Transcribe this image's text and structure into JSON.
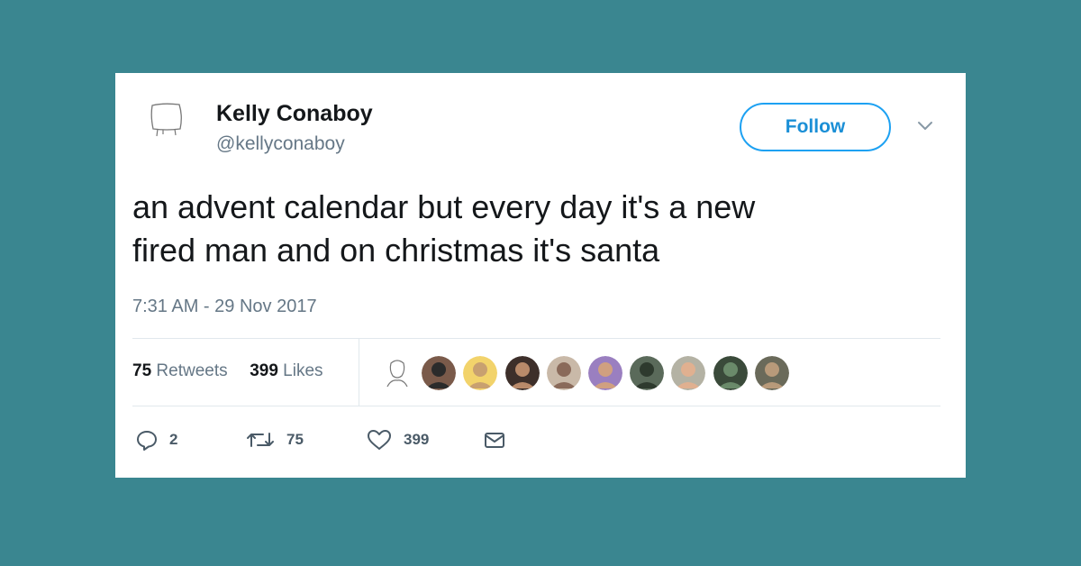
{
  "tweet": {
    "author_name": "Kelly Conaboy",
    "author_handle": "@kellyconaboy",
    "follow_label": "Follow",
    "text_line1": "an advent calendar but every day it's a new",
    "text_line2": "fired man and on christmas it's santa",
    "timestamp": "7:31 AM - 29 Nov 2017"
  },
  "stats": {
    "retweets_count": "75",
    "retweets_label": "Retweets",
    "likes_count": "399",
    "likes_label": "Likes"
  },
  "likers": [
    {
      "icon": "sketch-avatar-icon"
    },
    {
      "icon": "person-avatar-icon"
    },
    {
      "icon": "person-avatar-icon"
    },
    {
      "icon": "person-avatar-icon"
    },
    {
      "icon": "person-avatar-icon"
    },
    {
      "icon": "person-avatar-icon"
    },
    {
      "icon": "person-avatar-icon"
    },
    {
      "icon": "person-avatar-icon"
    },
    {
      "icon": "person-avatar-icon"
    },
    {
      "icon": "person-avatar-icon"
    }
  ],
  "actions": {
    "reply_count": "2",
    "retweet_count": "75",
    "like_count": "399"
  },
  "colors": {
    "background": "#3a8690",
    "accent": "#1da1f2",
    "text": "#14171a",
    "muted": "#657786"
  }
}
